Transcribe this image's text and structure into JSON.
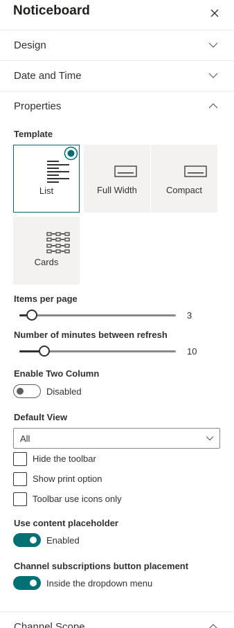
{
  "header": {
    "title": "Noticeboard"
  },
  "sections": {
    "design": "Design",
    "date_time": "Date and Time",
    "properties": "Properties",
    "channel_scope": "Channel Scope"
  },
  "template": {
    "label": "Template",
    "selected": "List",
    "options": [
      "List",
      "Full Width",
      "Compact",
      "Cards"
    ]
  },
  "items_per_page": {
    "label": "Items per page",
    "value": "3",
    "fraction": 0.08
  },
  "refresh_minutes": {
    "label": "Number of minutes between refresh",
    "value": "10",
    "fraction": 0.16
  },
  "two_column": {
    "label": "Enable Two Column",
    "state": "off",
    "text": "Disabled"
  },
  "default_view": {
    "label": "Default View",
    "value": "All"
  },
  "checkboxes": [
    {
      "label": "Hide the toolbar",
      "checked": false
    },
    {
      "label": "Show print option",
      "checked": false
    },
    {
      "label": "Toolbar use icons only",
      "checked": false
    }
  ],
  "content_placeholder": {
    "label": "Use content placeholder",
    "state": "on",
    "text": "Enabled"
  },
  "channel_subscriptions": {
    "label": "Channel subscriptions button placement",
    "state": "on",
    "text": "Inside the dropdown menu"
  },
  "colors": {
    "accent": "#037073",
    "selected_border": "#006b73",
    "tile_bg": "#f3f2f1"
  },
  "icons": [
    "close-icon",
    "chevron-down-icon",
    "chevron-up-icon",
    "radio-selected-icon",
    "list-template-icon",
    "full-width-template-icon",
    "compact-template-icon",
    "cards-template-icon"
  ]
}
